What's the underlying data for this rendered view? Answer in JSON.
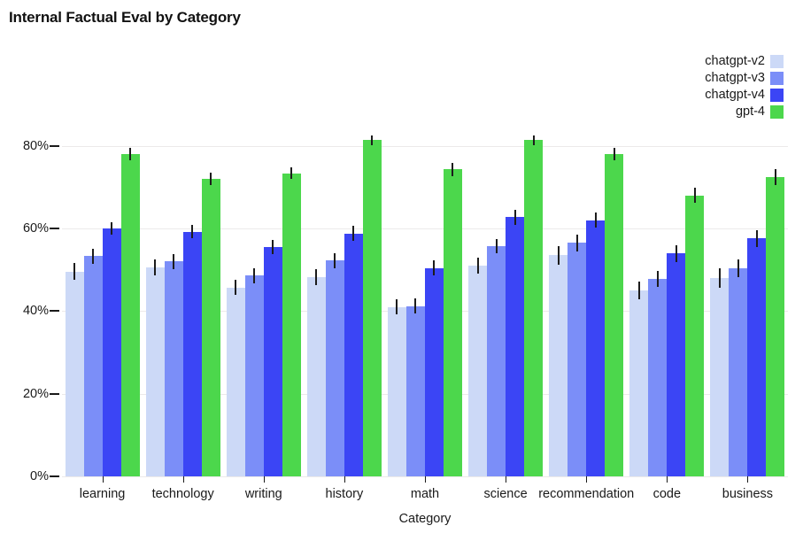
{
  "chart_data": {
    "type": "bar",
    "title": "Internal Factual Eval by Category",
    "xlabel": "Category",
    "ylabel": "",
    "ylim": [
      0,
      90
    ],
    "grid": true,
    "legend_position": "top-right",
    "ytick_labels": [
      "0%",
      "20%",
      "40%",
      "60%",
      "80%"
    ],
    "ytick_values": [
      0,
      20,
      40,
      60,
      80
    ],
    "categories": [
      "learning",
      "technology",
      "writing",
      "history",
      "math",
      "science",
      "recommendation",
      "code",
      "business"
    ],
    "series": [
      {
        "name": "chatgpt-v2",
        "color": "#ccd9f7",
        "values": [
          49.6,
          50.6,
          45.7,
          48.2,
          41.0,
          51.0,
          53.5,
          45.0,
          48.0
        ],
        "errors": [
          2.0,
          2.0,
          1.8,
          2.0,
          1.8,
          2.0,
          2.2,
          2.2,
          2.4
        ]
      },
      {
        "name": "chatgpt-v3",
        "color": "#7b8ef8",
        "values": [
          53.3,
          52.0,
          48.6,
          52.2,
          41.2,
          55.7,
          56.5,
          47.8,
          50.4
        ],
        "errors": [
          1.8,
          1.8,
          1.8,
          1.8,
          1.8,
          1.8,
          2.0,
          2.0,
          2.2
        ]
      },
      {
        "name": "chatgpt-v4",
        "color": "#3b45f5",
        "values": [
          60.0,
          59.2,
          55.5,
          58.8,
          50.4,
          62.7,
          62.0,
          53.9,
          57.6
        ],
        "errors": [
          1.6,
          1.6,
          1.8,
          1.8,
          1.8,
          1.8,
          1.8,
          2.0,
          2.0
        ]
      },
      {
        "name": "gpt-4",
        "color": "#4cd74c",
        "values": [
          78.0,
          72.0,
          73.3,
          81.4,
          74.3,
          81.4,
          78.0,
          68.0,
          72.4
        ],
        "errors": [
          1.6,
          1.4,
          1.4,
          1.2,
          1.6,
          1.2,
          1.4,
          1.8,
          2.0
        ]
      }
    ]
  },
  "legend": {
    "items": [
      {
        "label": "chatgpt-v2",
        "color": "#ccd9f7"
      },
      {
        "label": "chatgpt-v3",
        "color": "#7b8ef8"
      },
      {
        "label": "chatgpt-v4",
        "color": "#3b45f5"
      },
      {
        "label": "gpt-4",
        "color": "#4cd74c"
      }
    ]
  }
}
